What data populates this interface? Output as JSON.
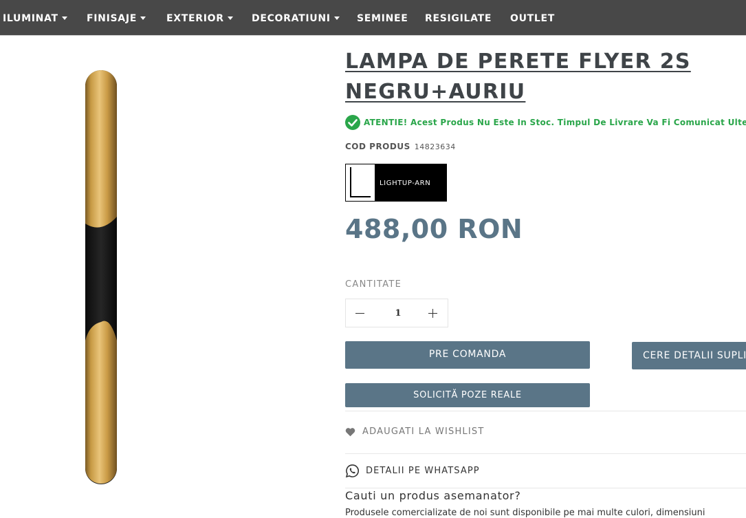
{
  "nav": {
    "items": [
      {
        "label": "ILUMINAT",
        "has_dropdown": true
      },
      {
        "label": "FINISAJE",
        "has_dropdown": true
      },
      {
        "label": "EXTERIOR",
        "has_dropdown": true
      },
      {
        "label": "DECORATIUNI",
        "has_dropdown": true
      },
      {
        "label": "SEMINEE",
        "has_dropdown": false
      },
      {
        "label": "RESIGILATE",
        "has_dropdown": false
      },
      {
        "label": "OUTLET",
        "has_dropdown": false
      }
    ]
  },
  "product": {
    "title": "LAMPA DE PERETE FLYER 2S NEGRU+AURIU",
    "stock_message": "ATENTIE! Acest Produs Nu Este In Stoc. Timpul De Livrare Va Fi Comunicat Ulterior",
    "code_label": "COD PRODUS",
    "code_value": "14823634",
    "brand_name": "LIGHTUP-ARN",
    "price": "488,00 RON",
    "quantity_label": "CANTITATE",
    "quantity": "1"
  },
  "actions": {
    "preorder_label": "PRE COMANDA",
    "details_label": "CERE DETALII SUPLIMENTARE",
    "photos_label": "SOLICITĂ POZE REALE",
    "wishlist_label": "ADAUGATI LA WISHLIST",
    "whatsapp_label": "DETALII PE WHATSAPP"
  },
  "similar": {
    "title": "Cauti un produs asemanator?",
    "text": "Produsele comercializate de noi sunt disponibile pe mai multe culori, dimensiuni"
  },
  "colors": {
    "nav_bg": "#484848",
    "accent": "#5a7587",
    "stock_green": "#2aa64a",
    "title": "#3f4448"
  },
  "icons": {
    "stock": "check-circle-icon",
    "wishlist": "heart-icon",
    "whatsapp": "whatsapp-icon",
    "nav_dropdown": "caret-down-icon",
    "qty_minus": "minus-icon",
    "qty_plus": "plus-icon"
  }
}
